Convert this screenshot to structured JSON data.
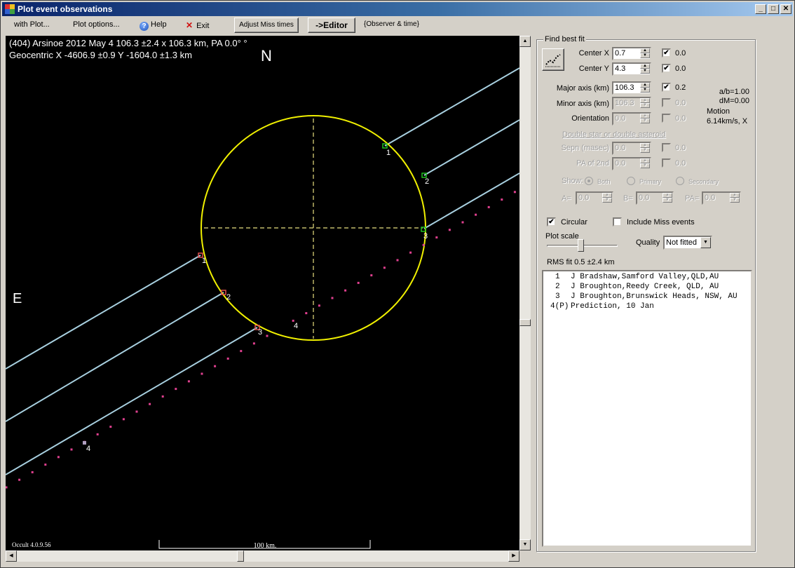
{
  "window": {
    "title": "Plot event observations",
    "controls": {
      "minimize": "_",
      "maximize": "□",
      "close": "✕"
    }
  },
  "menubar": {
    "with_plot": "with Plot...",
    "plot_options": "Plot options...",
    "help": "Help",
    "exit": "Exit",
    "adjust_miss_times": "Adjust Miss times",
    "editor": "->Editor",
    "observer_time": "{Observer & time}"
  },
  "plot": {
    "header_line1": "(404) Arsinoe  2012 May 4   106.3 ±2.4 x 106.3 km, PA 0.0° °",
    "header_line2": "Geocentric X -4606.9 ±0.9  Y -1604.0 ±1.3 km",
    "north_label": "N",
    "east_label": "E",
    "version": "Occult 4.0.9.56",
    "scale_label": "100 km.",
    "colors": {
      "background": "#000000",
      "ellipse": "#f0f000",
      "axes": "#e8e080",
      "chord": "#a8d0e0",
      "disappear_marker": "#e05050",
      "reappear_marker": "#20c020",
      "prediction_dots": "#e0408f",
      "label": "#ffffff"
    },
    "chord_labels": [
      "1",
      "2",
      "3",
      "4"
    ]
  },
  "panel": {
    "group_title": "Find best fit",
    "center_x": {
      "label": "Center X",
      "value": "0.7",
      "checked": true,
      "fit": "0.0"
    },
    "center_y": {
      "label": "Center Y",
      "value": "4.3",
      "checked": true,
      "fit": "0.0"
    },
    "major_axis": {
      "label": "Major axis (km)",
      "value": "106.3",
      "checked": true,
      "fit": "0.2"
    },
    "minor_axis": {
      "label": "Minor axis (km)",
      "value": "106.3",
      "checked": false,
      "fit": "0.0"
    },
    "orientation": {
      "label": "Orientation",
      "value": "0.0",
      "checked": false,
      "fit": "0.0"
    },
    "ab_ratio": "a/b=1.00",
    "dm": "dM=0.00",
    "motion_label": "Motion",
    "motion_value": "6.14km/s, X",
    "double_title": "Double star  or  double asteroid",
    "sepn": {
      "label": "Sepn (masec)",
      "value": "0.0",
      "fit": "0.0"
    },
    "pa_2nd": {
      "label": "PA of 2nd",
      "value": "0.0",
      "fit": "0.0"
    },
    "show_label": "Show:",
    "show_options": [
      "Both",
      "Primary",
      "Secondary"
    ],
    "show_selected": "Both",
    "a_label": "A=",
    "a_value": "0.0",
    "b_label": "B=",
    "b_value": "0.0",
    "pa_label": "PA=",
    "pa_value": "0.0",
    "circular_label": "Circular",
    "circular_checked": true,
    "include_miss_label": "Include Miss events",
    "include_miss_checked": false,
    "plot_scale_label": "Plot scale",
    "quality_label": "Quality",
    "quality_value": "Not fitted",
    "rms_fit": "RMS fit 0.5 ±2.4 km",
    "observations": [
      {
        "id": "1",
        "text": "J Bradshaw,Samford Valley,QLD,AU"
      },
      {
        "id": "2",
        "text": "J Broughton,Reedy Creek, QLD, AU"
      },
      {
        "id": "3",
        "text": "J Broughton,Brunswick Heads, NSW, AU"
      },
      {
        "id": "4(P)",
        "text": "Prediction, 10 Jan"
      }
    ]
  }
}
